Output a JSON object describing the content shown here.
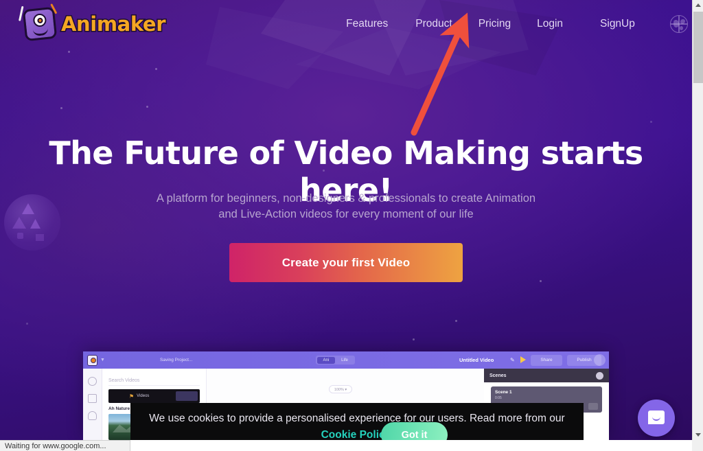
{
  "nav": {
    "logo_text": "Animaker",
    "links": [
      {
        "label": "Features"
      },
      {
        "label": "Product"
      },
      {
        "label": "Pricing"
      },
      {
        "label": "Login"
      },
      {
        "label": "SignUp"
      }
    ],
    "language_icon": "globe-icon"
  },
  "hero": {
    "headline": "The Future of Video Making starts here!",
    "subtitle_line1": "A platform for beginners, non-designers & professionals to create Animation",
    "subtitle_line2": "and Live-Action videos for every moment of our life",
    "cta_label": "Create your first Video"
  },
  "annotation": {
    "type": "arrow",
    "color": "#f0503c",
    "points_to": "Pricing"
  },
  "app_preview": {
    "saving_status": "Saving Project...",
    "toggle": {
      "left_label": "Ani",
      "right_label": "Life"
    },
    "project_title": "Untitled Video",
    "share_label": "Share",
    "publish_label": "Publish",
    "search_placeholder": "Search Videos",
    "video_row_label": "Videos",
    "category_label": "Ah Nature",
    "zoom_level": "100%",
    "scenes_header": "Scenes",
    "scene_name": "Scene 1",
    "scene_sub": "0:05"
  },
  "cookie": {
    "text_before": "We use cookies to provide a personalised experience for our users. Read more from our ",
    "link_label": "Cookie Policy.",
    "button_label": "Got it"
  },
  "chat": {
    "icon": "chat-bubble-icon"
  },
  "browser": {
    "status_text": "Waiting for www.google.com...",
    "scrollbar_position": "top"
  },
  "colors": {
    "background_purple": "#3c1191",
    "accent_orange": "#f5a623",
    "cta_gradient_start": "#cf2368",
    "cta_gradient_end": "#eea341",
    "cookie_link": "#25d2bd",
    "cookie_button": "#4fd6a8",
    "arrow_red": "#f0503c",
    "chat_purple": "#8466e8"
  }
}
